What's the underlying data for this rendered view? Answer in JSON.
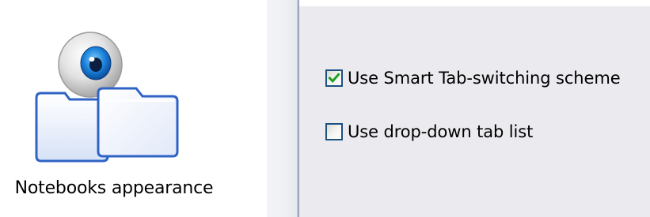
{
  "category": {
    "label": "Notebooks appearance",
    "icon": "notebooks-appearance-icon"
  },
  "options": [
    {
      "label": "Use Smart Tab-switching scheme",
      "checked": true
    },
    {
      "label": "Use drop-down tab list",
      "checked": false
    }
  ],
  "colors": {
    "panel_background": "#ebeaef",
    "checkbox_border": "#1c5180",
    "check_mark": "#21a121",
    "divider": "#9aa6bf"
  }
}
